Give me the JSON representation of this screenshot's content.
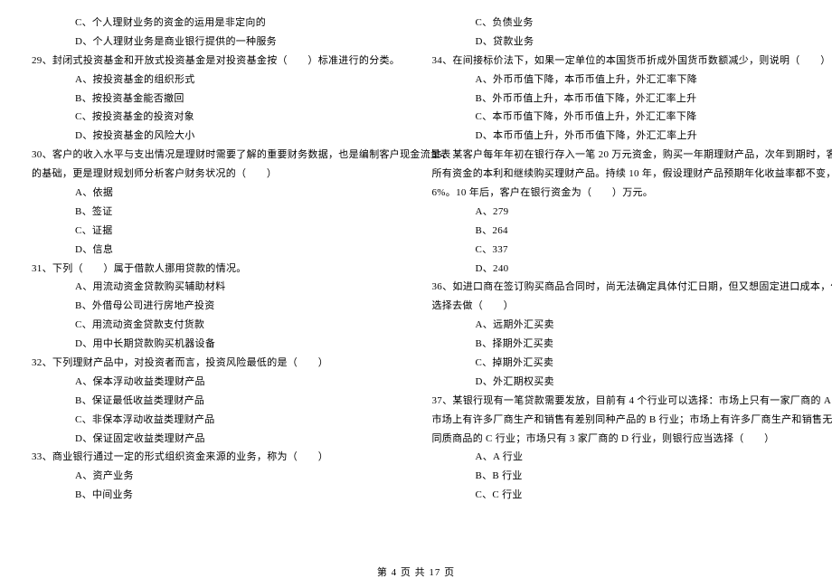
{
  "left": {
    "pre_opts": [
      "C、个人理财业务的资金的运用是非定向的",
      "D、个人理财业务是商业银行提供的一种服务"
    ],
    "q29": {
      "stem": "29、封闭式投资基金和开放式投资基金是对投资基金按（　　）标准进行的分类。",
      "opts": [
        "A、按投资基金的组织形式",
        "B、按投资基金能否撤回",
        "C、按投资基金的投资对象",
        "D、按投资基金的风险大小"
      ]
    },
    "q30": {
      "stem1": "30、客户的收入水平与支出情况是理财时需要了解的重要财务数据，也是编制客户现金流量表",
      "stem2": "的基础，更是理财规划师分析客户财务状况的（　　）",
      "opts": [
        "A、依据",
        "B、签证",
        "C、证据",
        "D、信息"
      ]
    },
    "q31": {
      "stem": "31、下列（　　）属于借款人挪用贷款的情况。",
      "opts": [
        "A、用流动资金贷款购买辅助材料",
        "B、外借母公司进行房地产投资",
        "C、用流动资金贷款支付货款",
        "D、用中长期贷款购买机器设备"
      ]
    },
    "q32": {
      "stem": "32、下列理财产品中，对投资者而言，投资风险最低的是（　　）",
      "opts": [
        "A、保本浮动收益类理财产品",
        "B、保证最低收益类理财产品",
        "C、非保本浮动收益类理财产品",
        "D、保证固定收益类理财产品"
      ]
    },
    "q33": {
      "stem": "33、商业银行通过一定的形式组织资金来源的业务，称为（　　）",
      "opts": [
        "A、资产业务",
        "B、中间业务"
      ]
    }
  },
  "right": {
    "pre_opts": [
      "C、负债业务",
      "D、贷款业务"
    ],
    "q34": {
      "stem": "34、在间接标价法下，如果一定单位的本国货币折成外国货币数额减少，则说明（　　）",
      "opts": [
        "A、外币币值下降，本币币值上升，外汇汇率下降",
        "B、外币币值上升，本币币值下降，外汇汇率上升",
        "C、本币币值下降，外币币值上升，外汇汇率下降",
        "D、本币币值上升，外币币值下降，外汇汇率上升"
      ]
    },
    "q35": {
      "stem1": "35、某客户每年年初在银行存入一笔 20 万元资金，购买一年期理财产品，次年到期时，客户将",
      "stem2": "所有资金的本利和继续购买理财产品。持续 10 年，假设理财产品预期年化收益率都不变，为",
      "stem3": "6%。10 年后，客户在银行资金为（　　）万元。",
      "opts": [
        "A、279",
        "B、264",
        "C、337",
        "D、240"
      ]
    },
    "q36": {
      "stem1": "36、如进口商在签订购买商品合同时，尚无法确定具体付汇日期，但又想固定进口成本，他应",
      "stem2": "选择去做（　　）",
      "opts": [
        "A、远期外汇买卖",
        "B、择期外汇买卖",
        "C、掉期外汇买卖",
        "D、外汇期权买卖"
      ]
    },
    "q37": {
      "stem1": "37、某银行现有一笔贷款需要发放，目前有 4 个行业可以选择：市场上只有一家厂商的 A 行业；",
      "stem2": "市场上有许多厂商生产和销售有差别同种产品的 B 行业；市场上有许多厂商生产和销售无差异",
      "stem3": "同质商品的 C 行业；市场只有 3 家厂商的 D 行业，则银行应当选择（　　）",
      "opts": [
        "A、A 行业",
        "B、B 行业",
        "C、C 行业"
      ]
    }
  },
  "footer": "第 4 页 共 17 页"
}
